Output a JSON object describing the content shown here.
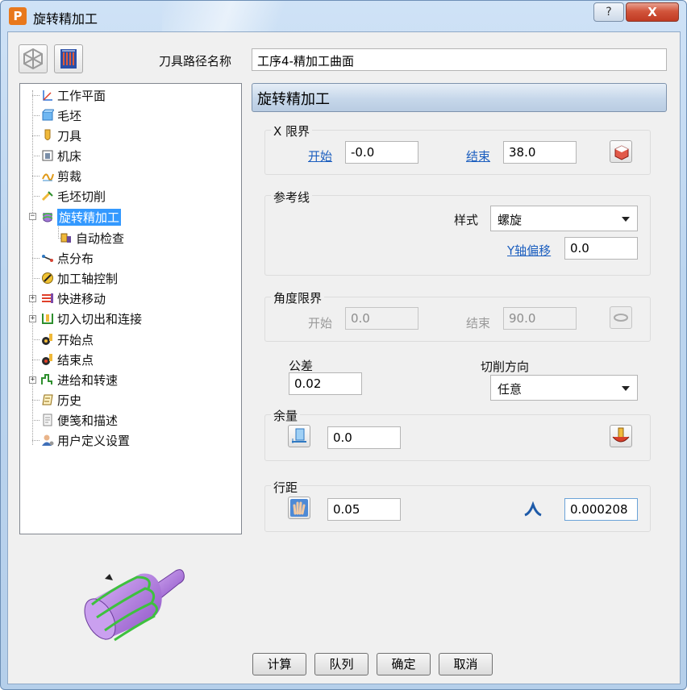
{
  "window": {
    "title": "旋转精加工",
    "help_label": "?",
    "close_label": "X",
    "app_letter": "P"
  },
  "toolpath": {
    "name_label": "刀具路径名称",
    "name_value": "工序4-精加工曲面"
  },
  "tree": [
    {
      "label": "工作平面",
      "icon": "workplane-icon"
    },
    {
      "label": "毛坯",
      "icon": "block-icon"
    },
    {
      "label": "刀具",
      "icon": "tool-icon"
    },
    {
      "label": "机床",
      "icon": "machine-icon"
    },
    {
      "label": "剪裁",
      "icon": "limit-icon"
    },
    {
      "label": "毛坯切削",
      "icon": "stock-cut-icon"
    },
    {
      "label": "旋转精加工",
      "icon": "rotary-finish-icon",
      "selected": true
    },
    {
      "label": "自动检查",
      "icon": "auto-verify-icon"
    },
    {
      "label": "点分布",
      "icon": "point-distribution-icon"
    },
    {
      "label": "加工轴控制",
      "icon": "axis-control-icon"
    },
    {
      "label": "快进移动",
      "icon": "rapid-move-icon"
    },
    {
      "label": "切入切出和连接",
      "icon": "leads-links-icon"
    },
    {
      "label": "开始点",
      "icon": "start-point-icon"
    },
    {
      "label": "结束点",
      "icon": "end-point-icon"
    },
    {
      "label": "进给和转速",
      "icon": "feeds-speeds-icon"
    },
    {
      "label": "历史",
      "icon": "history-icon"
    },
    {
      "label": "便笺和描述",
      "icon": "notes-icon"
    },
    {
      "label": "用户定义设置",
      "icon": "user-settings-icon"
    }
  ],
  "panel": {
    "header": "旋转精加工"
  },
  "x_limits": {
    "title": "X 限界",
    "start_label": "开始",
    "start_value": "-0.0",
    "end_label": "结束",
    "end_value": "38.0"
  },
  "reference_line": {
    "title": "参考线",
    "style_label": "样式",
    "style_value": "螺旋",
    "y_offset_label": "Y轴偏移",
    "y_offset_value": "0.0"
  },
  "angle_limits": {
    "title": "角度限界",
    "start_label": "开始",
    "start_value": "0.0",
    "end_label": "结束",
    "end_value": "90.0"
  },
  "tolerance": {
    "label": "公差",
    "value": "0.02"
  },
  "cut_direction": {
    "label": "切削方向",
    "value": "任意"
  },
  "thickness": {
    "title": "余量",
    "value": "0.0"
  },
  "stepover": {
    "title": "行距",
    "value": "0.05",
    "cusp_value": "0.000208"
  },
  "buttons": {
    "calculate": "计算",
    "queue": "队列",
    "ok": "确定",
    "cancel": "取消"
  },
  "colors": {
    "selection": "#3399ff",
    "link": "#1d5fbf",
    "header_bar": "#c6d7ea",
    "preview_body": "#b67ee6",
    "preview_spiral": "#3ec13e"
  }
}
